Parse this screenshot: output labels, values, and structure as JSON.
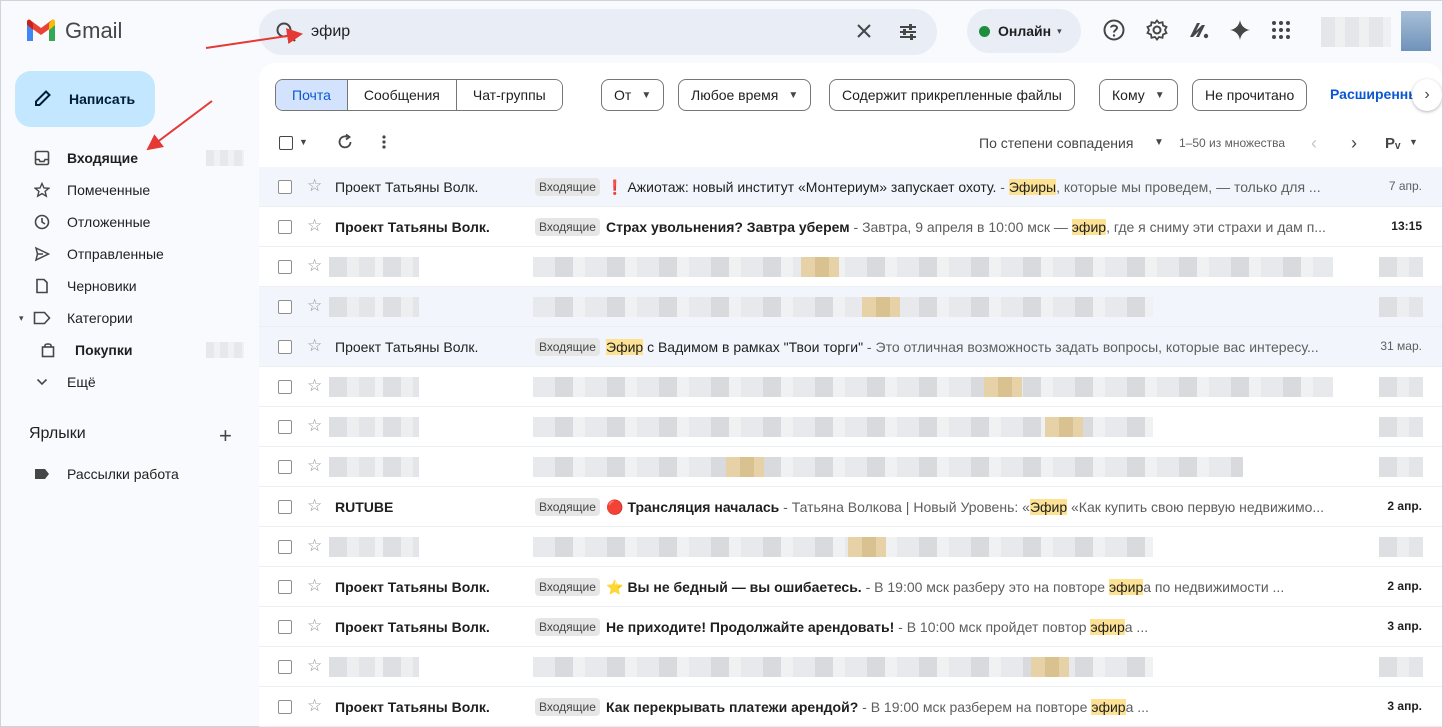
{
  "app": {
    "name": "Gmail"
  },
  "colors": {
    "accent": "#0b57d0",
    "compose_bg": "#c2e7ff",
    "status_green": "#1e8e3e",
    "highlight": "#fde293",
    "annotation_arrow": "#e53935"
  },
  "search": {
    "value": "эфир"
  },
  "status": {
    "label": "Онлайн"
  },
  "top_icons": [
    "help-icon",
    "settings-icon",
    "workspace-tools-icon",
    "gemini-icon",
    "apps-grid-icon"
  ],
  "compose": {
    "label": "Написать"
  },
  "sidebar": {
    "items": [
      {
        "label": "Входящие",
        "icon": "inbox-icon",
        "bold": true
      },
      {
        "label": "Помеченные",
        "icon": "star-icon"
      },
      {
        "label": "Отложенные",
        "icon": "clock-icon"
      },
      {
        "label": "Отправленные",
        "icon": "send-icon"
      },
      {
        "label": "Черновики",
        "icon": "draft-icon"
      },
      {
        "label": "Категории",
        "icon": "label-icon"
      },
      {
        "label": "Покупки",
        "icon": "shopping-bag-icon",
        "bold": true
      },
      {
        "label": "Ещё",
        "icon": "chevron-down-icon"
      }
    ],
    "labels_heading": "Ярлыки",
    "labels_add": "+",
    "user_labels": [
      {
        "label": "Рассылки работа",
        "icon": "label-tag-icon"
      }
    ]
  },
  "tabs": [
    "Почта",
    "Сообщения",
    "Чат-группы"
  ],
  "filters": {
    "from": "От",
    "time": "Любое время",
    "attachments": "Содержит прикрепленные файлы",
    "to": "Кому",
    "unread": "Не прочитано",
    "advanced": "Расширенный"
  },
  "toolbar": {
    "sort_label": "По степени совпадения",
    "range_label": "1–50 из множества",
    "input_tools": "Рᵥ"
  },
  "messages": [
    {
      "sender": "Проект Татьяны Волк.",
      "badge": "Входящие",
      "prefix": "❗",
      "subj_a": "Ажиотаж: новый институт «Монтериум» запускает охоту.",
      "subj_hl": "",
      "subj_b": "",
      "sep": " - ",
      "snip_a": "",
      "snip_hl": "Эфиры",
      "snip_b": ", которые мы проведем, — только для ...",
      "date": "7 апр.",
      "unread": false
    },
    {
      "sender": "Проект Татьяны Волк.",
      "badge": "Входящие",
      "prefix": "",
      "subj_a": "Страх увольнения? Завтра уберем",
      "subj_hl": "",
      "subj_b": "",
      "sep": " - ",
      "snip_a": "Завтра, 9 апреля в 10:00 мск — ",
      "snip_hl": "эфир",
      "snip_b": ", где я сниму эти страхи и дам п...",
      "date": "13:15",
      "unread": true
    },
    {
      "blurred": true,
      "read": false
    },
    {
      "blurred": true,
      "read": true
    },
    {
      "sender": "Проект Татьяны Волк.",
      "badge": "Входящие",
      "prefix": "",
      "subj_a": "",
      "subj_hl": "Эфир",
      "subj_b": " с Вадимом в рамках \"Твои торги\"",
      "sep": " - ",
      "snip_a": "Это отличная возможность задать вопросы, которые вас интересу...",
      "snip_hl": "",
      "snip_b": "",
      "date": "31 мар.",
      "unread": false
    },
    {
      "blurred": true,
      "read": false
    },
    {
      "blurred": true,
      "read": false
    },
    {
      "blurred": true,
      "read": false
    },
    {
      "sender": "RUTUBE",
      "badge": "Входящие",
      "prefix": "🔴",
      "subj_a": "Трансляция началась",
      "subj_hl": "",
      "subj_b": "",
      "sep": " - ",
      "snip_a": "Татьяна Волкова | Новый Уровень: «",
      "snip_hl": "Эфир",
      "snip_b": " «Как купить свою первую недвижимо...",
      "date": "2 апр.",
      "unread": true
    },
    {
      "blurred": true,
      "read": false
    },
    {
      "sender": "Проект Татьяны Волк.",
      "badge": "Входящие",
      "prefix": "⭐",
      "subj_a": "Вы не бедный — вы ошибаетесь.",
      "subj_hl": "",
      "subj_b": "",
      "sep": " - ",
      "snip_a": "В 19:00 мск разберу это на повторе ",
      "snip_hl": "эфир",
      "snip_b": "а по недвижимости ...",
      "date": "2 апр.",
      "unread": true
    },
    {
      "sender": "Проект Татьяны Волк.",
      "badge": "Входящие",
      "prefix": "",
      "subj_a": "Не приходите! Продолжайте арендовать!",
      "subj_hl": "",
      "subj_b": "",
      "sep": " - ",
      "snip_a": "В 10:00 мск пройдет повтор ",
      "snip_hl": "эфир",
      "snip_b": "а ...",
      "date": "3 апр.",
      "unread": true
    },
    {
      "blurred": true,
      "read": false
    },
    {
      "sender": "Проект Татьяны Волк.",
      "badge": "Входящие",
      "prefix": "",
      "subj_a": "Как перекрывать платежи арендой?",
      "subj_hl": "",
      "subj_b": "",
      "sep": " - ",
      "snip_a": "В 19:00 мск разберем на повторе ",
      "snip_hl": "эфир",
      "snip_b": "а ...",
      "date": "3 апр.",
      "unread": true
    }
  ]
}
